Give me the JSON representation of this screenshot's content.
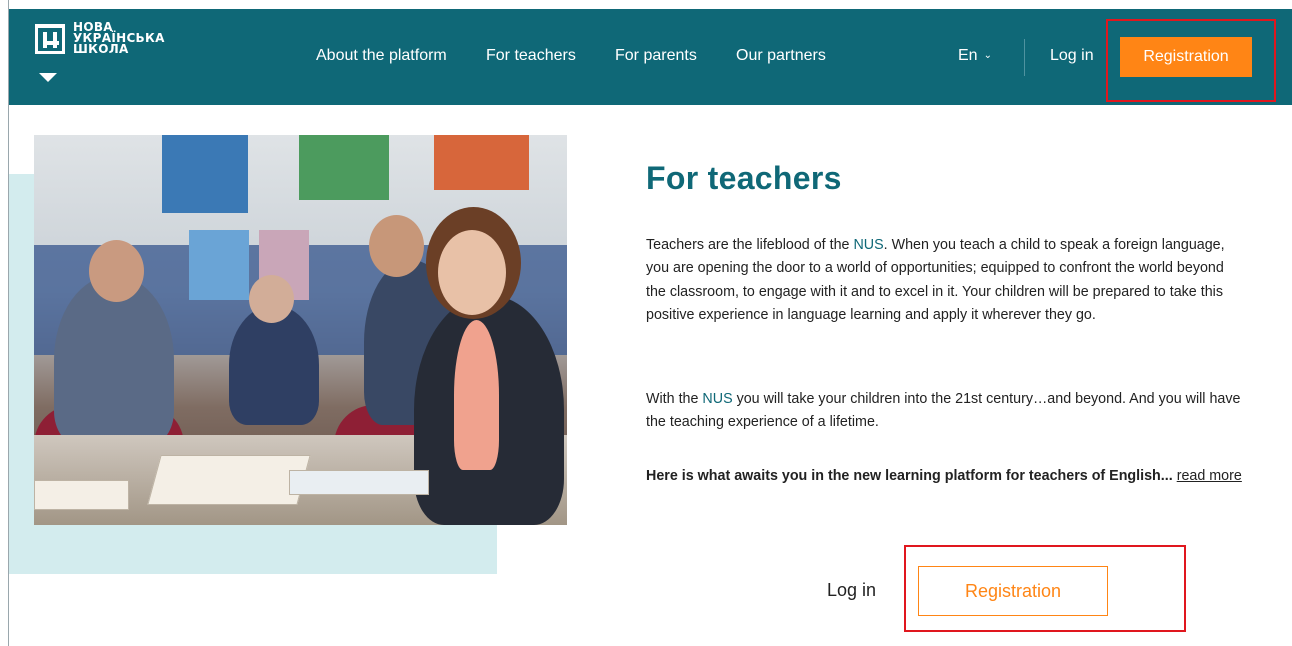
{
  "header": {
    "logo_lines": [
      "НОВА",
      "УКРАЇНСЬКА",
      "ШКОЛА"
    ],
    "nav": [
      {
        "label": "About the platform"
      },
      {
        "label": "For teachers"
      },
      {
        "label": "For parents"
      },
      {
        "label": "Our partners"
      }
    ],
    "language": "En",
    "login_label": "Log in",
    "registration_label": "Registration"
  },
  "main": {
    "title": "For teachers",
    "paragraph1_part1": "Teachers are the lifeblood of the ",
    "nus": "NUS",
    "paragraph1_part2": ". When you teach a child to speak a foreign language, you are opening the door to a world of opportunities; equipped to confront the world beyond the classroom, to engage with it and to excel in it. Your children will be prepared to take this positive experience in language learning and apply it wherever they go.",
    "paragraph2_part1": "With the ",
    "paragraph2_part2": " you will take your children into the 21st century…and beyond. And you will have the teaching experience of a lifetime.",
    "paragraph3": "Here is what awaits you in the new learning platform for teachers of English... ",
    "read_more": "read more",
    "login_label": "Log in",
    "registration_label": "Registration"
  },
  "colors": {
    "header_bg": "#0f6877",
    "accent_orange": "#ff8515",
    "highlight_red": "#e0171e",
    "teal_light": "#d3ecee"
  },
  "icons": {
    "logo": "nus-logo-icon",
    "language_toggle": "chevron-down-icon",
    "menu_toggle": "triangle-down-icon"
  }
}
